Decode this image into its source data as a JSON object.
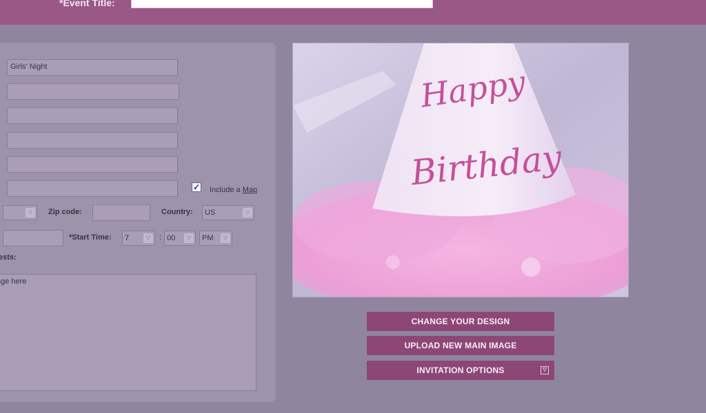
{
  "header": {
    "event_title_label": "*Event Title:",
    "event_title_value": ""
  },
  "form": {
    "field_1_value": "Girls' Night",
    "field_2_value": "",
    "field_3_value": "",
    "field_4_value": "",
    "field_5_value": "",
    "field_6_value": "",
    "include_map_text": "Include a ",
    "include_map_link": "Map",
    "include_map_checked": true,
    "zip_label": "Zip code:",
    "zip_value": "",
    "country_label": "Country:",
    "country_value": "US",
    "start_time_label": "*Start Time:",
    "start_hour": "7",
    "start_minute": "00",
    "start_ampm": "PM",
    "message_label": "ests:",
    "message_placeholder": "age here"
  },
  "image": {
    "caption_line1": "Happy",
    "caption_line2": "Birthday"
  },
  "actions": {
    "change_design": "CHANGE YOUR DESIGN",
    "upload_image": "UPLOAD NEW MAIN IMAGE",
    "invitation_options": "INVITATION OPTIONS"
  },
  "colors": {
    "background": "#8f859f",
    "header": "#9a5887",
    "button": "#8d4776"
  }
}
